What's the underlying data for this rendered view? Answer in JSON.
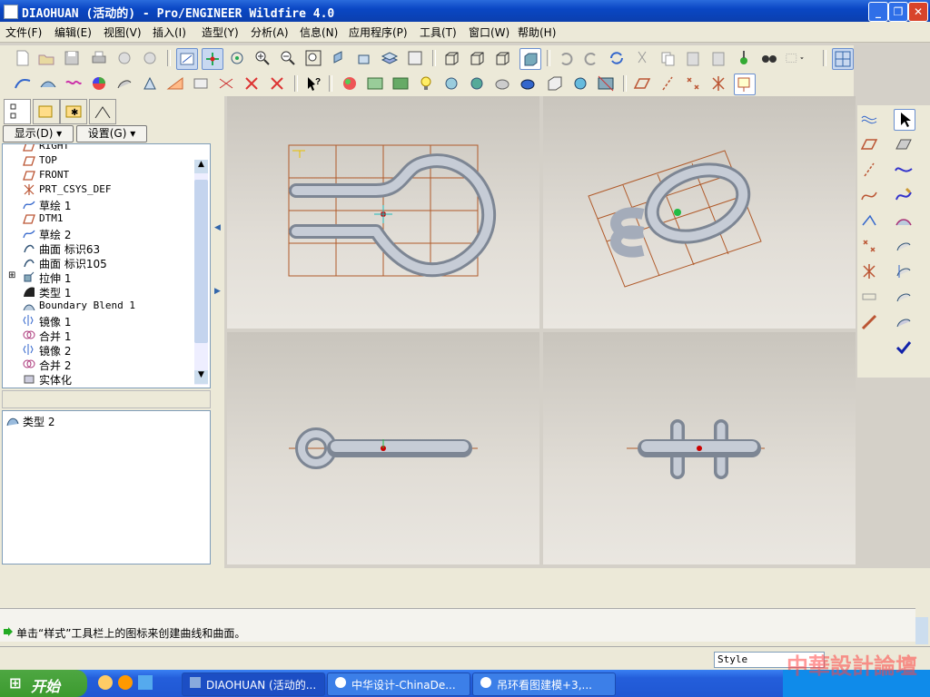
{
  "window": {
    "title": "DIAOHUAN (活动的) - Pro/ENGINEER Wildfire 4.0"
  },
  "menu": [
    "文件(F)",
    "编辑(E)",
    "视图(V)",
    "插入(I)",
    "造型(Y)",
    "分析(A)",
    "信息(N)",
    "应用程序(P)",
    "工具(T)",
    "窗口(W)",
    "帮助(H)"
  ],
  "left_panel": {
    "show_button": "显示(D) ▾",
    "settings_button": "设置(G) ▾",
    "tree_items": [
      {
        "label": "RIGHT",
        "icon": "datum-plane-icon",
        "mono": true
      },
      {
        "label": "TOP",
        "icon": "datum-plane-icon",
        "mono": true
      },
      {
        "label": "FRONT",
        "icon": "datum-plane-icon",
        "mono": true
      },
      {
        "label": "PRT_CSYS_DEF",
        "icon": "csys-icon",
        "mono": true
      },
      {
        "label": "草绘 1",
        "icon": "sketch-icon",
        "mono": false
      },
      {
        "label": "DTM1",
        "icon": "datum-plane-icon",
        "mono": true
      },
      {
        "label": "草绘 2",
        "icon": "sketch-icon",
        "mono": false
      },
      {
        "label": "曲面 标识63",
        "icon": "surface-icon",
        "mono": false
      },
      {
        "label": "曲面 标识105",
        "icon": "surface-icon",
        "mono": false
      },
      {
        "label": "拉伸 1",
        "icon": "extrude-icon",
        "mono": false
      },
      {
        "label": "类型 1",
        "icon": "style-icon",
        "mono": false
      },
      {
        "label": "Boundary Blend 1",
        "icon": "boundary-blend-icon",
        "mono": true
      },
      {
        "label": "镜像 1",
        "icon": "mirror-icon",
        "mono": false
      },
      {
        "label": "合并 1",
        "icon": "merge-icon",
        "mono": false
      },
      {
        "label": "镜像 2",
        "icon": "mirror-icon",
        "mono": false
      },
      {
        "label": "合并 2",
        "icon": "merge-icon",
        "mono": false
      },
      {
        "label": "实体化",
        "icon": "solidify-icon",
        "mono": false
      }
    ],
    "lower_item": "类型 2"
  },
  "message": "单击“样式”工具栏上的图标来创建曲线和曲面。",
  "filter": {
    "value": "Style"
  },
  "taskbar": {
    "start": "开始",
    "tasks": [
      "DIAOHUAN (活动的...",
      "中华设计-ChinaDe...",
      "吊环看图建模+3,..."
    ]
  },
  "watermark": "中華設計論壇",
  "colors": {
    "titlebar": "#0a47c4",
    "viewport_bg": "#d9d5ce",
    "datum": "#b05a2a",
    "taskbar": "#245edb"
  }
}
